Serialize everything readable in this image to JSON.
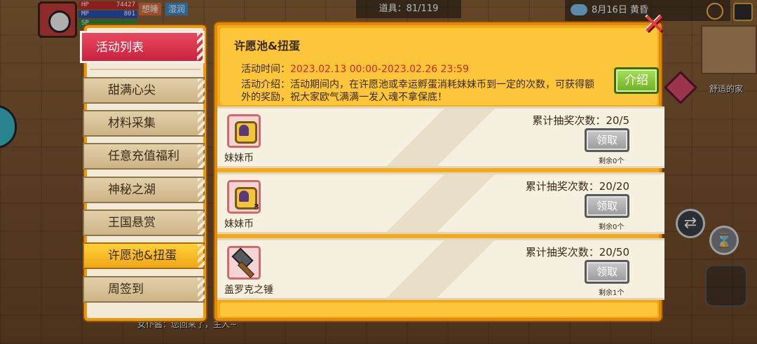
{
  "hud": {
    "hp_label": "HP",
    "hp_value": "74427",
    "mp_label": "MP",
    "mp_value": "801",
    "sp_label": "SP",
    "status_1": "想睡",
    "status_2": "湿润",
    "items": "道具：81/119",
    "date": "8月16日 黄昏",
    "home_label": "舒适的家",
    "chat_line": "女仆酱：您回来了，主人~"
  },
  "sidebar": {
    "items": [
      {
        "label": "活动列表"
      },
      {
        "label": "甜满心尖"
      },
      {
        "label": "材料采集"
      },
      {
        "label": "任意充值福利"
      },
      {
        "label": "神秘之湖"
      },
      {
        "label": "王国悬赏"
      },
      {
        "label": "许愿池&扭蛋"
      },
      {
        "label": "周签到"
      }
    ]
  },
  "event": {
    "title": "许愿池&扭蛋",
    "time_label": "活动时间：",
    "time_value": "2023.02.13 00:00-2023.02.26 23:59",
    "desc": "活动介绍：活动期间内，在许愿池或幸运孵蛋消耗妹妹币到一定的次数，可获得额外的奖励，祝大家欧气满满一发入魂不拿保底！",
    "intro_button": "介绍"
  },
  "rewards": [
    {
      "name": "妹妹币",
      "count": "",
      "progress": "累计抽奖次数：20/5",
      "button": "领取",
      "remain": "剩余0个",
      "icon": "coin-icon"
    },
    {
      "name": "妹妹币",
      "count": "3",
      "progress": "累计抽奖次数：20/20",
      "button": "领取",
      "remain": "剩余0个",
      "icon": "coin-icon"
    },
    {
      "name": "盖罗克之锤",
      "count": "",
      "progress": "累计抽奖次数：20/50",
      "button": "领取",
      "remain": "剩余1个",
      "icon": "hammer-icon"
    }
  ],
  "colors": {
    "panel_orange": "#f5a91c",
    "header_yellow": "#fbc63a",
    "active_red": "#c9223f",
    "selected_yellow": "#f0a617",
    "date_red": "#d6231f",
    "intro_green": "#6cb022",
    "claim_gray": "#9a9a9a"
  }
}
